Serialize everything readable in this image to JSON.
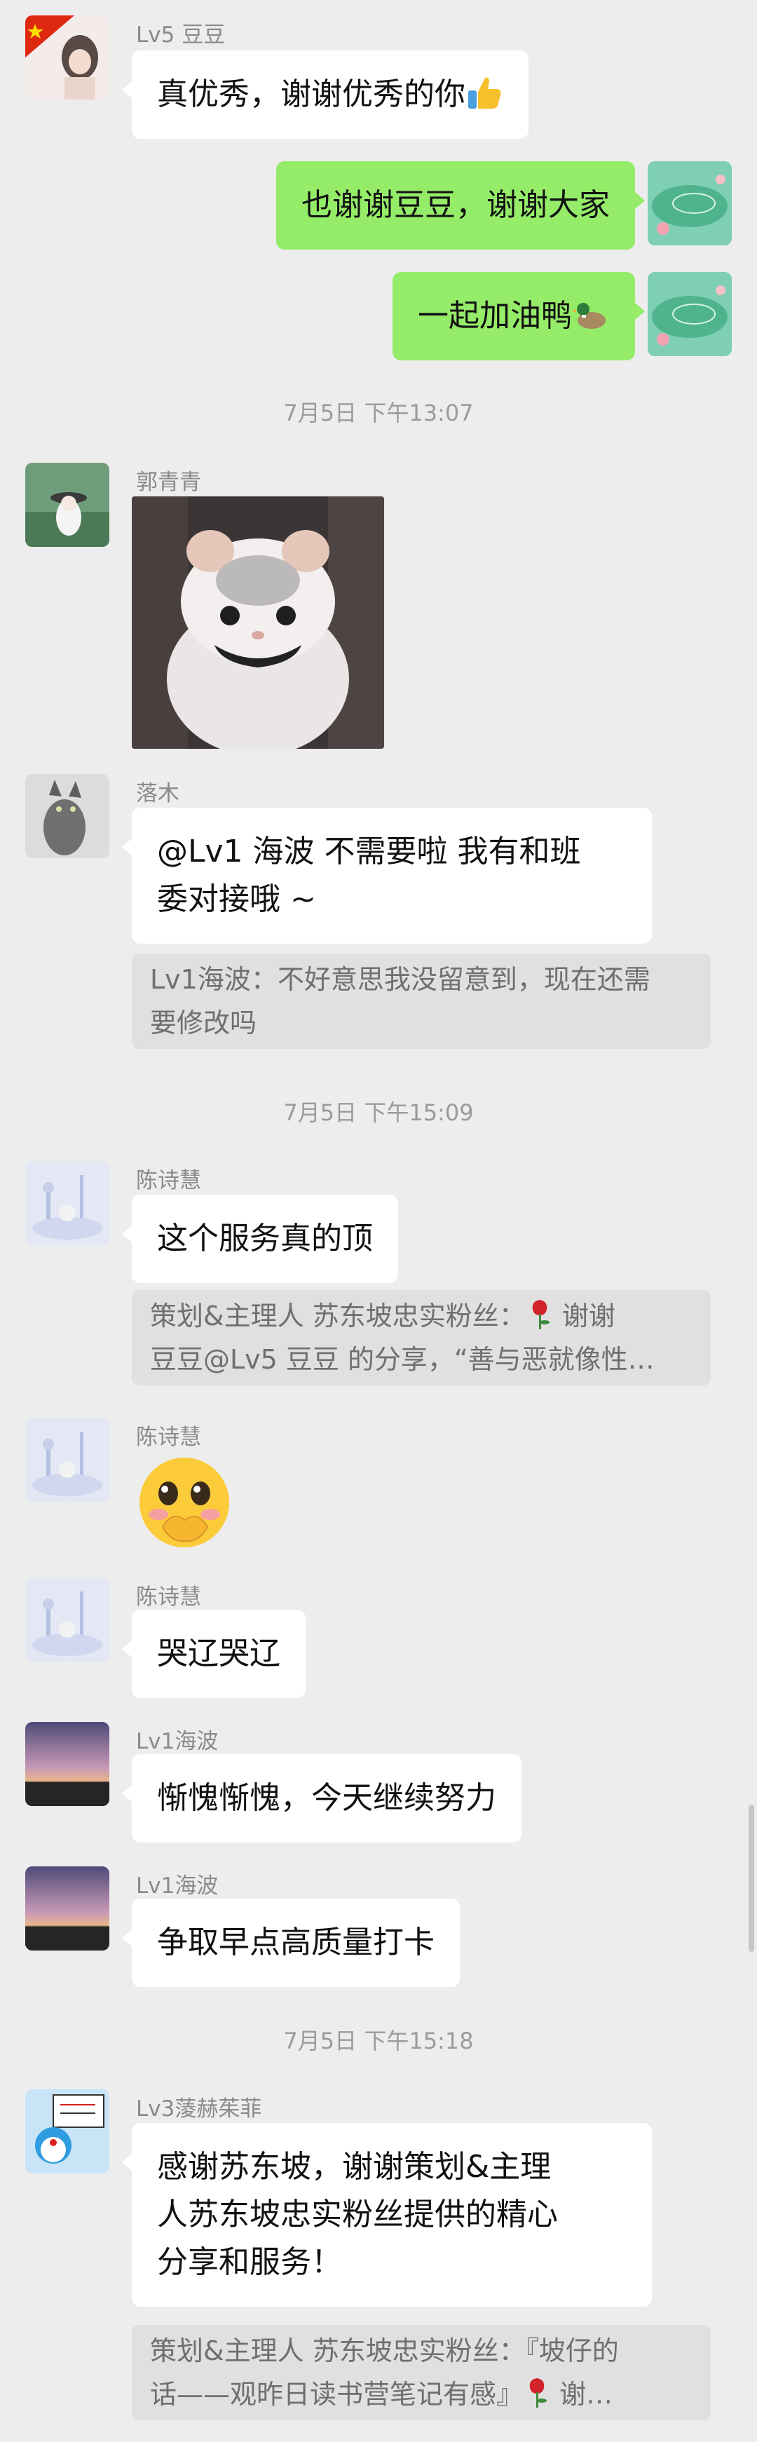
{
  "messages": {
    "m1": {
      "sender": "Lv5 豆豆",
      "text": "真优秀，谢谢优秀的你",
      "emoji": "thumbs-up"
    },
    "m2": {
      "text": "也谢谢豆豆，谢谢大家"
    },
    "m3": {
      "text": "一起加油鸭",
      "emoji": "duck"
    },
    "t1": "7月5日 下午13:07",
    "m4": {
      "sender": "郭青青",
      "image": "cat-photo"
    },
    "m5": {
      "sender": "落木",
      "line1": "@Lv1 海波  不需要啦 我有和班",
      "line2": "委对接哦 ~",
      "quote_line1": "Lv1海波：不好意思我没留意到，现在还需",
      "quote_line2": "要修改吗"
    },
    "t2": "7月5日 下午15:09",
    "m6": {
      "sender": "陈诗慧",
      "text": "这个服务真的顶",
      "quote_line1a": "策划&主理人  苏东坡忠实粉丝：",
      "quote_line1b": "谢谢",
      "quote_line2": "豆豆@Lv5 豆豆 的分享，“善与恶就像性…"
    },
    "m7": {
      "sender": "陈诗慧",
      "emoji": "shy-face"
    },
    "m8": {
      "sender": "陈诗慧",
      "text": "哭辽哭辽"
    },
    "m9": {
      "sender": "Lv1海波",
      "text": "惭愧惭愧，今天继续努力"
    },
    "m10": {
      "sender": "Lv1海波",
      "text": "争取早点高质量打卡"
    },
    "t3": "7月5日 下午15:18",
    "m11": {
      "sender": "Lv3蔆赫茱菲",
      "line1": "感谢苏东坡，谢谢策划&主理",
      "line2": "人苏东坡忠实粉丝提供的精心",
      "line3": "分享和服务！",
      "quote_line1": "策划&主理人  苏东坡忠实粉丝：『坡仔的",
      "quote_line2a": "话——观昨日读书营笔记有感』",
      "quote_line2b": "谢…"
    }
  },
  "colors": {
    "background": "#ededed",
    "my_bubble": "#95ec69",
    "other_bubble": "#ffffff",
    "quote_bg": "#e0e0e0"
  }
}
